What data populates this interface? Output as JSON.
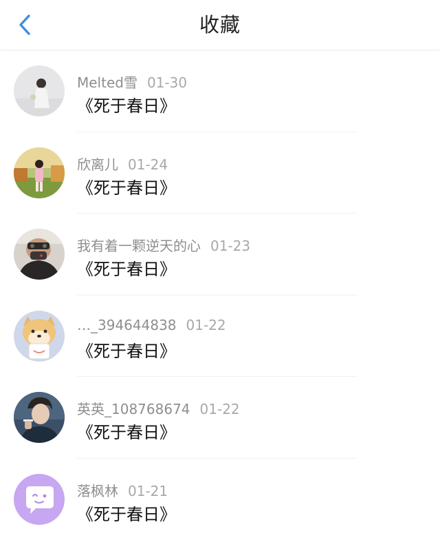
{
  "header": {
    "title": "收藏",
    "back_icon": "chevron-left-icon",
    "accent_color": "#3a8ee6"
  },
  "items": [
    {
      "user": "Melted雪",
      "date": "01-30",
      "title": "《死于春日》",
      "avatar": "photo-avatar-girl-white"
    },
    {
      "user": "欣离儿",
      "date": "01-24",
      "title": "《死于春日》",
      "avatar": "photo-avatar-girl-garden"
    },
    {
      "user": "我有着一颗逆天的心",
      "date": "01-23",
      "title": "《死于春日》",
      "avatar": "photo-avatar-masked-man"
    },
    {
      "user": "…_394644838",
      "date": "01-22",
      "title": "《死于春日》",
      "avatar": "cartoon-dog-avatar"
    },
    {
      "user": "英英_108768674",
      "date": "01-22",
      "title": "《死于春日》",
      "avatar": "photo-avatar-man-smoking"
    },
    {
      "user": "落枫林",
      "date": "01-21",
      "title": "《死于春日》",
      "avatar": "default-chat-bubble-avatar"
    }
  ]
}
